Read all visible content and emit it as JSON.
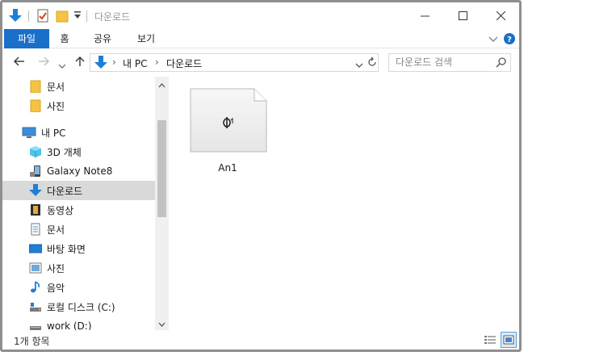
{
  "window": {
    "title": "다운로드"
  },
  "ribbon": {
    "tabs": [
      "파일",
      "홈",
      "공유",
      "보기"
    ]
  },
  "address": {
    "root": "내 PC",
    "current": "다운로드"
  },
  "search": {
    "placeholder": "다운로드 검색"
  },
  "nav": {
    "items": [
      {
        "label": "문서",
        "icon": "folder-icon",
        "indent": 1
      },
      {
        "label": "사진",
        "icon": "folder-icon",
        "indent": 1
      },
      {
        "label": "내 PC",
        "icon": "computer-icon",
        "indent": 0
      },
      {
        "label": "3D 개체",
        "icon": "3d-objects-icon",
        "indent": 1
      },
      {
        "label": "Galaxy Note8",
        "icon": "phone-icon",
        "indent": 1
      },
      {
        "label": "다운로드",
        "icon": "download-icon",
        "indent": 1,
        "selected": true
      },
      {
        "label": "동영상",
        "icon": "video-icon",
        "indent": 1
      },
      {
        "label": "문서",
        "icon": "document-icon",
        "indent": 1
      },
      {
        "label": "바탕 화면",
        "icon": "desktop-icon",
        "indent": 1
      },
      {
        "label": "사진",
        "icon": "pictures-icon",
        "indent": 1
      },
      {
        "label": "음악",
        "icon": "music-icon",
        "indent": 1
      },
      {
        "label": "로컬 디스크 (C:)",
        "icon": "drive-icon",
        "indent": 1
      },
      {
        "label": "work (D:)",
        "icon": "drive-icon",
        "indent": 1
      }
    ]
  },
  "files": [
    {
      "name": "An1",
      "icon": "generic-file-icon"
    }
  ],
  "status": {
    "count": "1개 항목"
  },
  "colors": {
    "accent": "#1a6fc9",
    "selected": "#d9d9d9",
    "folder": "#f5c242"
  }
}
